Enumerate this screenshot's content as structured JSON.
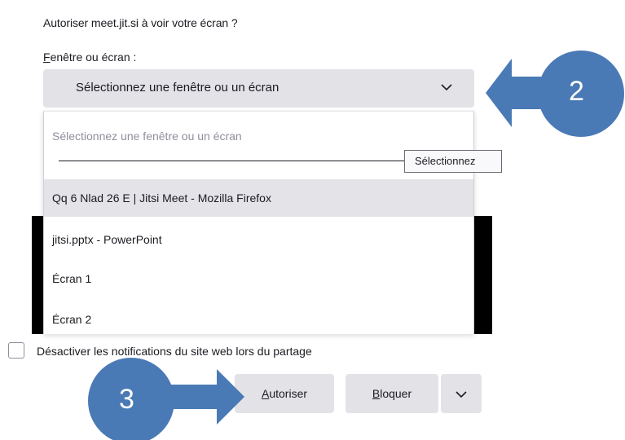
{
  "prompt": {
    "title": "Autoriser meet.jit.si à voir votre écran ?",
    "field_label_first": "F",
    "field_label_rest": "enêtre ou écran :"
  },
  "select": {
    "label": "Sélectionnez une fenêtre ou un écran"
  },
  "dropdown": {
    "placeholder": "Sélectionnez une fenêtre ou un écran",
    "options": [
      {
        "label": "Qq 6 Nlad 26 E | Jitsi Meet - Mozilla Firefox"
      },
      {
        "label": "jitsi.pptx - PowerPoint"
      },
      {
        "label": "Écran 1"
      },
      {
        "label": "Écran 2"
      }
    ]
  },
  "tooltip": {
    "text": "Sélectionnez"
  },
  "checkbox": {
    "label": "Désactiver les notifications du site web lors du partage"
  },
  "buttons": {
    "allow_first": "A",
    "allow_rest": "utoriser",
    "block_first": "B",
    "block_rest": "loquer"
  },
  "annotations": {
    "step2": "2",
    "step3": "3",
    "color": "#4a7ab5"
  }
}
